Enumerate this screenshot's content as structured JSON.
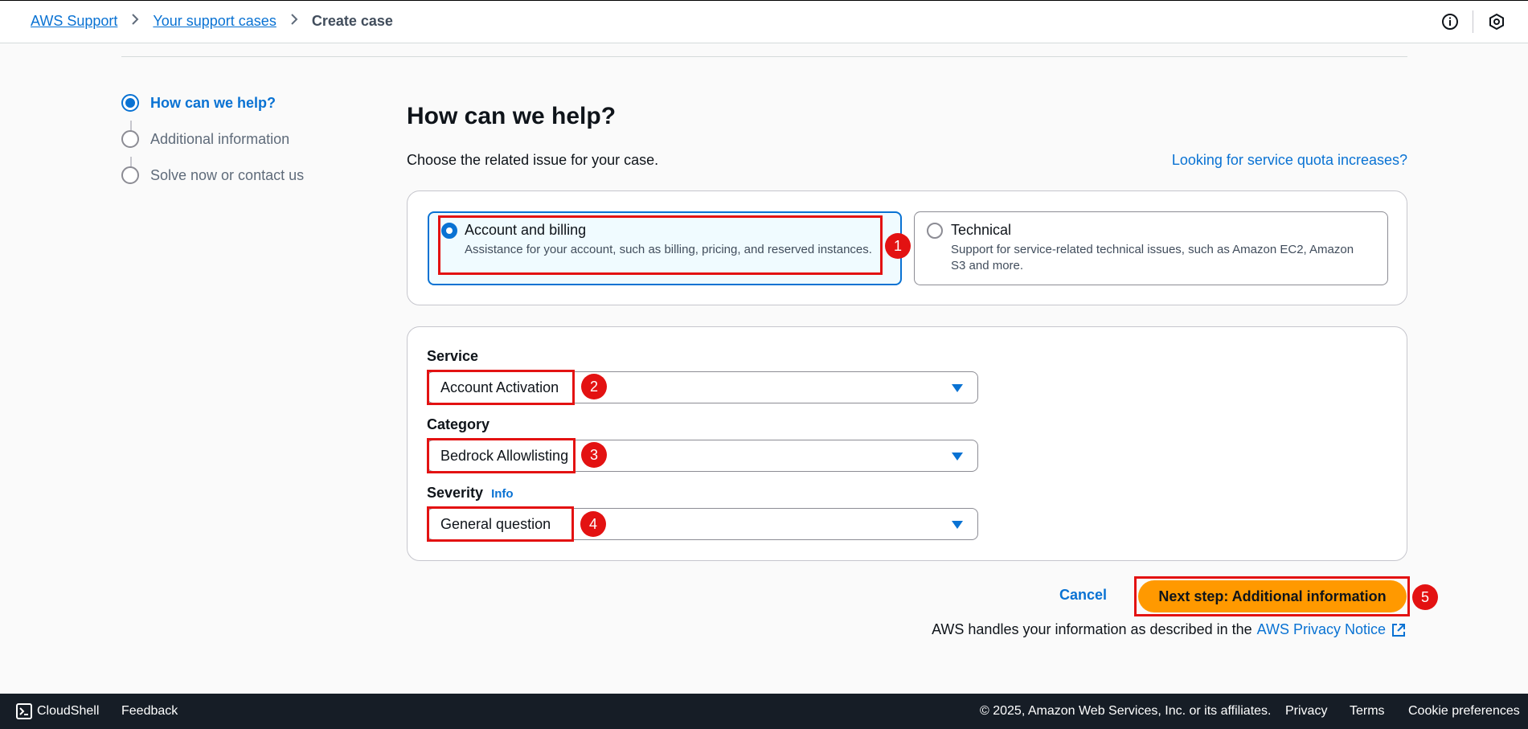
{
  "breadcrumb": {
    "items": [
      "AWS Support",
      "Your support cases"
    ],
    "current": "Create case",
    "separator": ">"
  },
  "steps": [
    {
      "label": "How can we help?",
      "active": true
    },
    {
      "label": "Additional information",
      "active": false
    },
    {
      "label": "Solve now or contact us",
      "active": false
    }
  ],
  "main": {
    "title": "How can we help?",
    "subtitle": "Choose the related issue for your case.",
    "quota_link": "Looking for service quota increases?"
  },
  "issue_types": [
    {
      "title": "Account and billing",
      "description": "Assistance for your account, such as billing, pricing, and reserved instances.",
      "selected": true
    },
    {
      "title": "Technical",
      "description_line1": "Support for service-related technical issues, such as Amazon EC2, Amazon",
      "description_line2": "S3 and more.",
      "selected": false
    }
  ],
  "form": {
    "service": {
      "label": "Service",
      "value": "Account Activation"
    },
    "category": {
      "label": "Category",
      "value": "Bedrock Allowlisting"
    },
    "severity": {
      "label": "Severity",
      "info": "Info",
      "value": "General question"
    }
  },
  "actions": {
    "cancel": "Cancel",
    "next": "Next step: Additional information"
  },
  "privacy": {
    "text": "AWS handles your information as described in the",
    "link": "AWS Privacy Notice"
  },
  "annotations": [
    "1",
    "2",
    "3",
    "4",
    "5"
  ],
  "footer": {
    "cloudshell": "CloudShell",
    "feedback": "Feedback",
    "copyright": "© 2025, Amazon Web Services, Inc. or its affiliates.",
    "privacy": "Privacy",
    "terms": "Terms",
    "cookies": "Cookie preferences"
  },
  "colors": {
    "accent": "#0972d3",
    "primary_button": "#ff9900",
    "annotation": "#e31212",
    "footer_bg": "#161d26"
  }
}
